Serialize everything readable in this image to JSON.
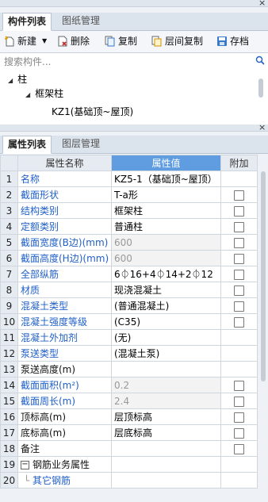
{
  "top_panel": {
    "close_glyph": "×",
    "tabs": [
      {
        "label": "构件列表",
        "active": true
      },
      {
        "label": "图纸管理",
        "active": false
      }
    ],
    "toolbar": {
      "new_label": "新建",
      "delete_label": "删除",
      "copy_label": "复制",
      "floor_copy_label": "层间复制",
      "save_label": "存档"
    },
    "search_placeholder": "搜索构件...",
    "tree": {
      "root": "柱",
      "group": "框架柱",
      "item": "KZ1(基础顶~屋顶)"
    }
  },
  "bottom_panel": {
    "close_glyph": "×",
    "tabs": [
      {
        "label": "属性列表",
        "active": true
      },
      {
        "label": "图层管理",
        "active": false
      }
    ],
    "table": {
      "headers": {
        "name": "属性名称",
        "value": "属性值",
        "extra": "附加"
      },
      "rows": [
        {
          "num": "1",
          "name": "名称",
          "value": "KZ5-1（基础顶~屋顶）",
          "blue": true,
          "gray": false,
          "checkbox": false
        },
        {
          "num": "2",
          "name": "截面形状",
          "value": "T-a形",
          "blue": true,
          "gray": false,
          "checkbox": true
        },
        {
          "num": "3",
          "name": "结构类别",
          "value": "框架柱",
          "blue": true,
          "gray": false,
          "checkbox": true
        },
        {
          "num": "4",
          "name": "定额类别",
          "value": "普通柱",
          "blue": true,
          "gray": false,
          "checkbox": true
        },
        {
          "num": "5",
          "name": "截面宽度(B边)(mm)",
          "value": "600",
          "blue": true,
          "gray": true,
          "checkbox": true
        },
        {
          "num": "6",
          "name": "截面高度(H边)(mm)",
          "value": "600",
          "blue": true,
          "gray": true,
          "checkbox": true
        },
        {
          "num": "7",
          "name": "全部纵筋",
          "value": "6⏀16+4⏀14+2⏀12",
          "blue": true,
          "gray": false,
          "checkbox": true
        },
        {
          "num": "8",
          "name": "材质",
          "value": "现浇混凝土",
          "blue": true,
          "gray": false,
          "checkbox": true
        },
        {
          "num": "9",
          "name": "混凝土类型",
          "value": "(普通混凝土)",
          "blue": true,
          "gray": false,
          "checkbox": true
        },
        {
          "num": "10",
          "name": "混凝土强度等级",
          "value": "(C35)",
          "blue": true,
          "gray": false,
          "checkbox": true
        },
        {
          "num": "11",
          "name": "混凝土外加剂",
          "value": "(无)",
          "blue": true,
          "gray": false,
          "checkbox": false
        },
        {
          "num": "12",
          "name": "泵送类型",
          "value": "(混凝土泵)",
          "blue": true,
          "gray": false,
          "checkbox": false
        },
        {
          "num": "13",
          "name": "泵送高度(m)",
          "value": "",
          "blue": false,
          "gray": false,
          "checkbox": false
        },
        {
          "num": "14",
          "name": "截面面积(m²)",
          "value": "0.2",
          "blue": true,
          "gray": true,
          "checkbox": true
        },
        {
          "num": "15",
          "name": "截面周长(m)",
          "value": "2.4",
          "blue": true,
          "gray": true,
          "checkbox": true
        },
        {
          "num": "16",
          "name": "顶标高(m)",
          "value": "层顶标高",
          "blue": false,
          "gray": false,
          "checkbox": true
        },
        {
          "num": "17",
          "name": "底标高(m)",
          "value": "层底标高",
          "blue": false,
          "gray": false,
          "checkbox": true
        },
        {
          "num": "18",
          "name": "备注",
          "value": "",
          "blue": false,
          "gray": false,
          "checkbox": true
        },
        {
          "num": "19",
          "name": "钢筋业务属性",
          "value": "",
          "blue": false,
          "gray": false,
          "checkbox": false,
          "group": true
        },
        {
          "num": "20",
          "name": "其它钢筋",
          "value": "",
          "blue": true,
          "gray": false,
          "checkbox": false,
          "child": true
        }
      ]
    }
  },
  "colors": {
    "header_accent": "#5f9de0",
    "link_blue": "#2060c8"
  },
  "icons": [
    "new-icon",
    "delete-icon",
    "copy-icon",
    "floor-copy-icon",
    "save-icon",
    "search-icon",
    "collapse-icon"
  ]
}
